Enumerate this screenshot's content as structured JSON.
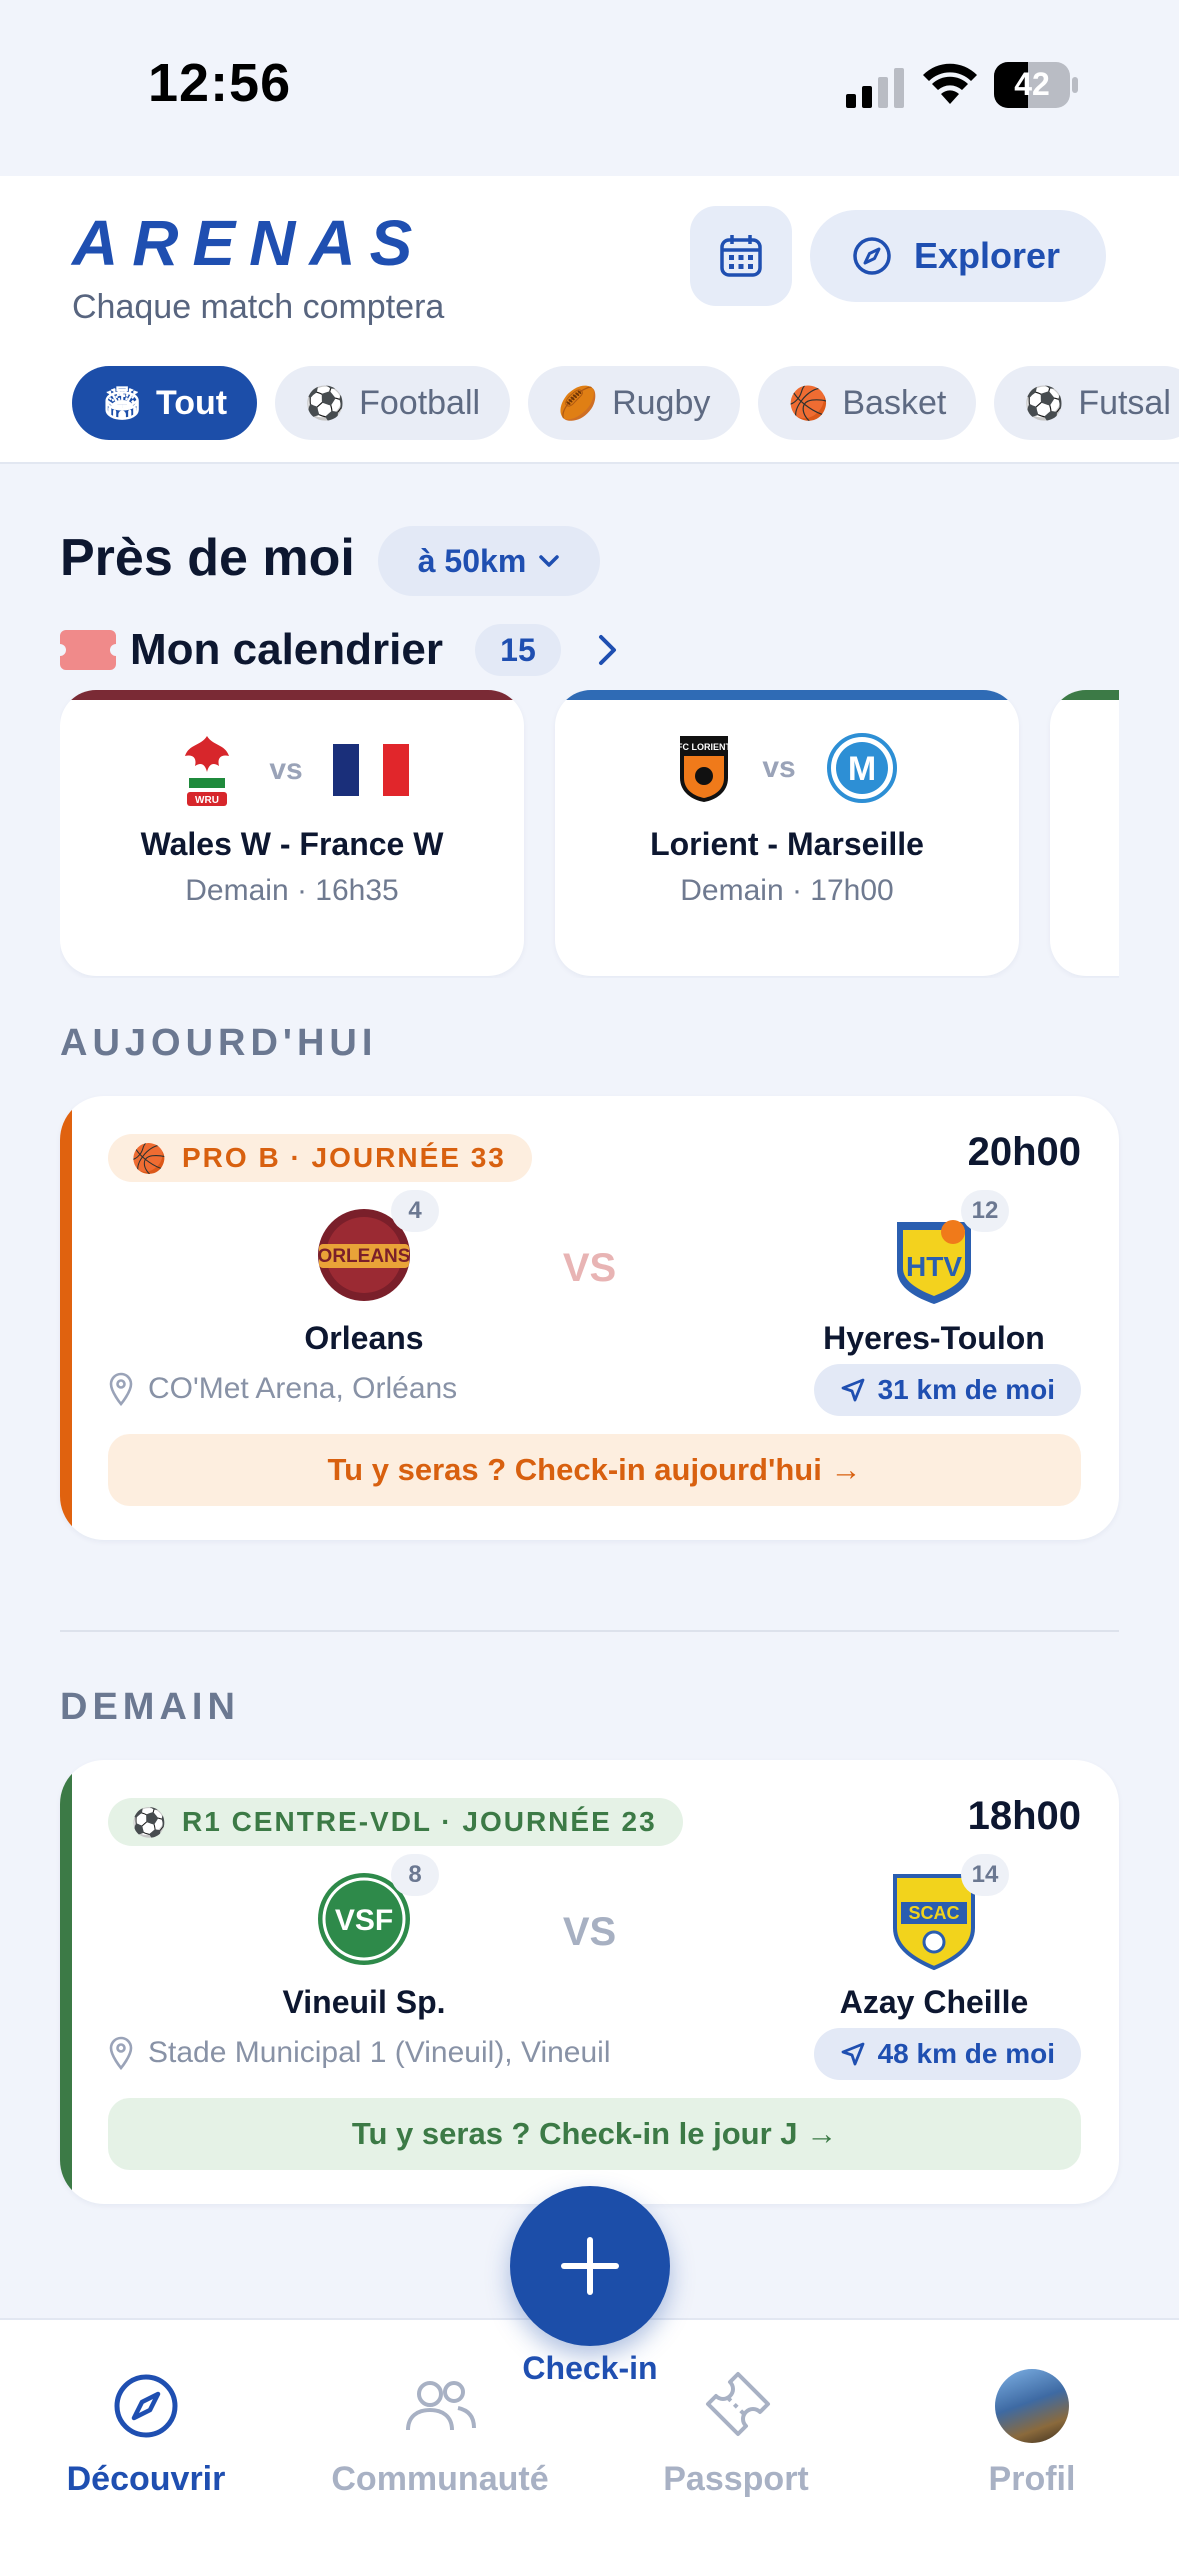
{
  "status_bar": {
    "time": "12:56",
    "battery": "42"
  },
  "header": {
    "brand": "ARENAS",
    "tagline": "Chaque match comptera",
    "explore_label": "Explorer",
    "filters": [
      {
        "label": "Tout",
        "icon": "stadium-icon",
        "active": true
      },
      {
        "label": "Football",
        "icon": "soccer-ball-icon",
        "active": false
      },
      {
        "label": "Rugby",
        "icon": "rugby-ball-icon",
        "active": false
      },
      {
        "label": "Basket",
        "icon": "basketball-icon",
        "active": false
      },
      {
        "label": "Futsal",
        "icon": "soccer-ball-icon",
        "active": false
      }
    ]
  },
  "near_me": {
    "title": "Près de moi",
    "radius": "à 50km"
  },
  "my_calendar": {
    "title": "Mon calendrier",
    "count": "15",
    "cards": [
      {
        "match": "Wales W - France W",
        "when": "Demain · 16h35",
        "accent": "#7a2a35"
      },
      {
        "match": "Lorient - Marseille",
        "when": "Demain · 17h00",
        "accent": "#2f6bb5"
      }
    ]
  },
  "vs_text": "vs",
  "sections": {
    "today": "AUJOURD'HUI",
    "tomorrow": "DEMAIN"
  },
  "matches": [
    {
      "league": "PRO B · JOURNÉE 33",
      "time": "20h00",
      "home": {
        "name": "Orleans",
        "rank": "4"
      },
      "away": {
        "name": "Hyeres-Toulon",
        "rank": "12"
      },
      "middle": "VS",
      "venue": "CO'Met Arena, Orléans",
      "distance": "31 km de moi",
      "cta": "Tu y seras ? Check-in aujourd'hui →",
      "accent": "#e0620f"
    },
    {
      "league": "R1 CENTRE-VDL · JOURNÉE 23",
      "time": "18h00",
      "home": {
        "name": "Vineuil Sp.",
        "rank": "8"
      },
      "away": {
        "name": "Azay Cheille",
        "rank": "14"
      },
      "middle": "VS",
      "venue": "Stade Municipal 1 (Vineuil), Vineuil",
      "distance": "48 km de moi",
      "cta": "Tu y seras ? Check-in le jour J →",
      "accent": "#3c7a46"
    }
  ],
  "fab": {
    "label": "Check-in"
  },
  "tabbar": {
    "tabs": [
      {
        "label": "Découvrir",
        "active": true
      },
      {
        "label": "Communauté",
        "active": false
      },
      {
        "label": "Passport",
        "active": false
      },
      {
        "label": "Profil",
        "active": false
      }
    ]
  }
}
